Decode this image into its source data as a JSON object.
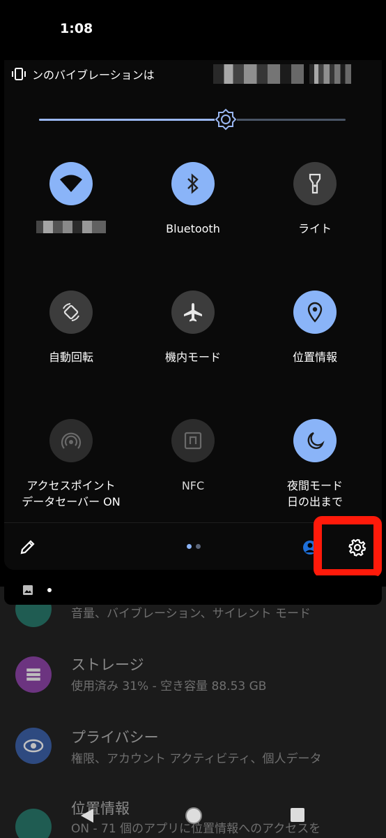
{
  "status_bar": {
    "time": "1:08"
  },
  "vibration_notice": {
    "text": "ンのバイブレーションは"
  },
  "brightness": {
    "level": 0.61
  },
  "tiles": [
    {
      "id": "wifi",
      "label": "",
      "state": "on",
      "icon": "wifi-icon"
    },
    {
      "id": "bluetooth",
      "label": "Bluetooth",
      "state": "on",
      "icon": "bluetooth-icon"
    },
    {
      "id": "flashlight",
      "label": "ライト",
      "state": "off",
      "icon": "flashlight-icon"
    },
    {
      "id": "auto-rotate",
      "label": "自動回転",
      "state": "off",
      "icon": "rotate-icon"
    },
    {
      "id": "airplane",
      "label": "機内モード",
      "state": "off",
      "icon": "airplane-icon"
    },
    {
      "id": "location",
      "label": "位置情報",
      "state": "on",
      "icon": "location-pin-icon"
    },
    {
      "id": "hotspot",
      "label": "アクセスポイント",
      "sublabel": "データセーバー ON",
      "state": "unavailable",
      "icon": "hotspot-icon"
    },
    {
      "id": "nfc",
      "label": "NFC",
      "state": "unavailable",
      "icon": "nfc-icon"
    },
    {
      "id": "night-mode",
      "label": "夜間モード",
      "sublabel": "日の出まで",
      "state": "on",
      "icon": "moon-icon"
    }
  ],
  "background_list": [
    {
      "title": "",
      "subtitle": "音量、バイブレーション、サイレント モード",
      "icon": "sound-icon",
      "color": "#2e8b7a"
    },
    {
      "title": "ストレージ",
      "subtitle": "使用済み 31% - 空き容量 88.53 GB",
      "icon": "storage-icon",
      "color": "#9b3fb5"
    },
    {
      "title": "プライバシー",
      "subtitle": "権限、アカウント アクティビティ、個人データ",
      "icon": "privacy-eye-icon",
      "color": "#3f5fa8"
    },
    {
      "title": "位置情報",
      "subtitle": "ON - 71 個のアプリに位置情報へのアクセスを",
      "icon": "location-icon",
      "color": "#2e8b7a"
    }
  ],
  "colors": {
    "accent": "#8ab4f8",
    "highlight": "#ff1a0a"
  }
}
